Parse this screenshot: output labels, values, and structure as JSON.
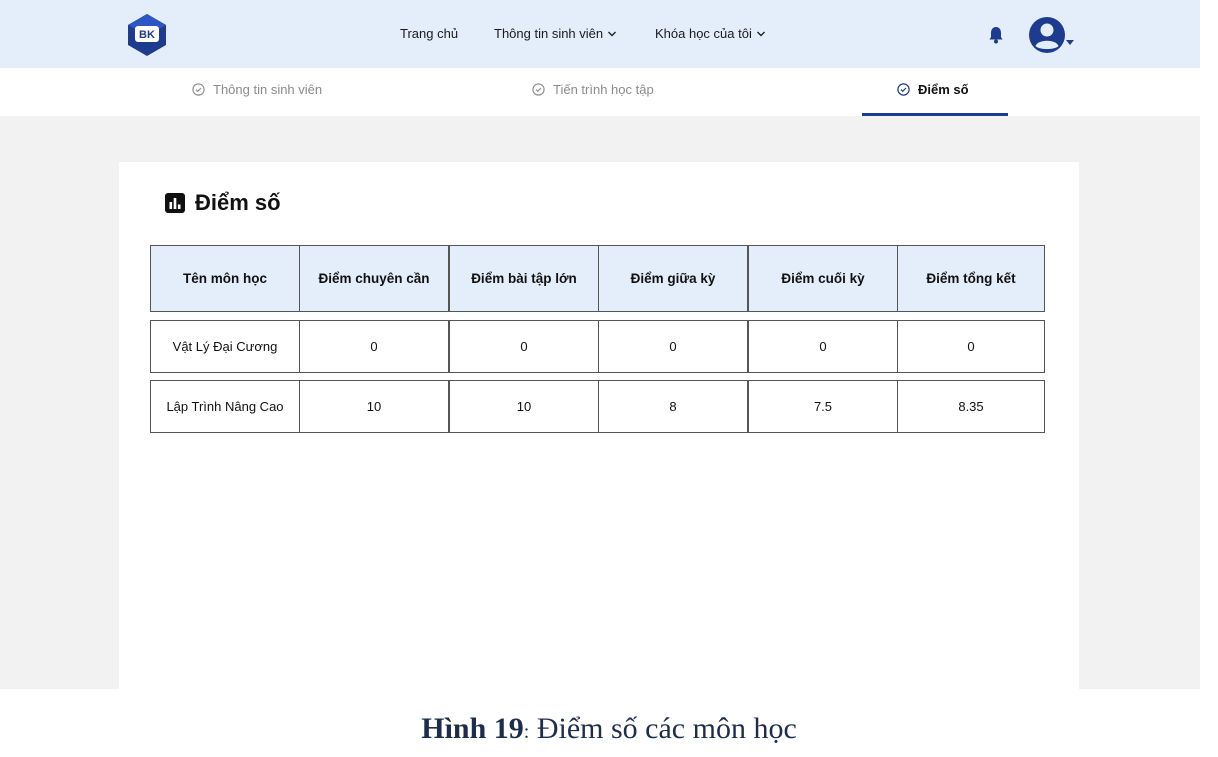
{
  "header": {
    "logo_text": "BK",
    "nav": [
      {
        "label": "Trang chủ",
        "has_dropdown": false
      },
      {
        "label": "Thông tin sinh viên",
        "has_dropdown": true
      },
      {
        "label": "Khóa học của tôi",
        "has_dropdown": true
      }
    ],
    "icons": [
      "bell-icon",
      "user-avatar-icon"
    ]
  },
  "tabs": [
    {
      "label": "Thông tin sinh viên",
      "active": false
    },
    {
      "label": "Tiến trình học tập",
      "active": false
    },
    {
      "label": "Điểm số",
      "active": true
    }
  ],
  "main": {
    "title": "Điểm số",
    "table": {
      "headers": [
        "Tên môn học",
        "Điểm chuyên cần",
        "Điểm bài tập lớn",
        "Điểm giữa kỳ",
        "Điểm cuối kỳ",
        "Điểm tổng kết"
      ],
      "rows": [
        [
          "Vật Lý Đại Cương",
          "0",
          "0",
          "0",
          "0",
          "0"
        ],
        [
          "Lập Trình Nâng Cao",
          "10",
          "10",
          "8",
          "7.5",
          "8.35"
        ]
      ]
    }
  },
  "caption": {
    "label": "Hình 19",
    "separator": ":",
    "text": " Điểm số các môn học"
  },
  "colors": {
    "header_bg": "#e4edfa",
    "accent": "#1d3b8f",
    "page_bg": "#f2f2f2"
  }
}
